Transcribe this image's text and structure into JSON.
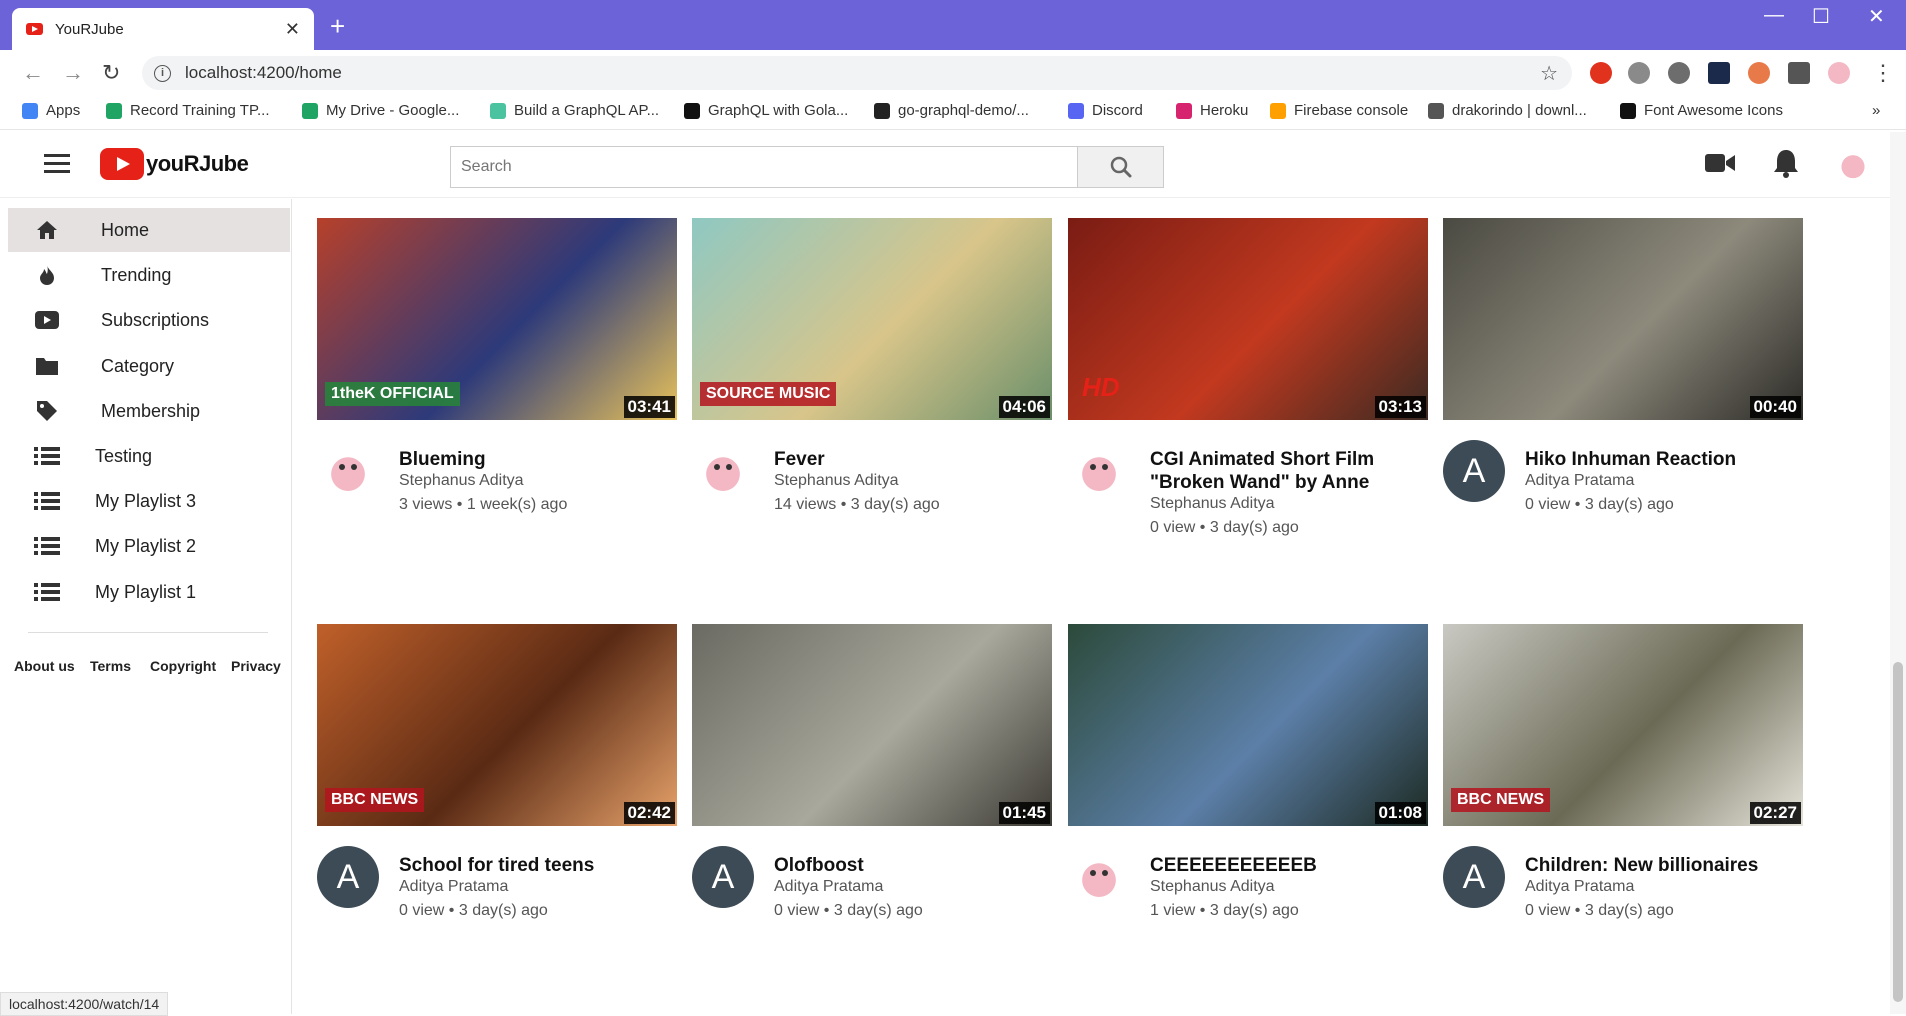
{
  "browser": {
    "tab_title": "YouRJube",
    "tab_close": "✕",
    "new_tab": "+",
    "minimize": "—",
    "maximize": "☐",
    "close": "✕",
    "url": "localhost:4200/home",
    "bookmarks": [
      {
        "label": "Apps",
        "color": "#4285f4"
      },
      {
        "label": "Record Training TP...",
        "color": "#1fa463"
      },
      {
        "label": "My Drive - Google...",
        "color": "#1fa463"
      },
      {
        "label": "Build a GraphQL AP...",
        "color": "#4cc3a0"
      },
      {
        "label": "GraphQL with Gola...",
        "color": "#111111"
      },
      {
        "label": "go-graphql-demo/...",
        "color": "#222222"
      },
      {
        "label": "Discord",
        "color": "#5865f2"
      },
      {
        "label": "Heroku",
        "color": "#d6246e"
      },
      {
        "label": "Firebase console",
        "color": "#ffa000"
      },
      {
        "label": "drakorindo | downl...",
        "color": "#555555"
      },
      {
        "label": "Font Awesome Icons",
        "color": "#111111"
      }
    ],
    "bookmarks_more": "»",
    "status_url": "localhost:4200/watch/14"
  },
  "header": {
    "brand": "youRJube",
    "search_placeholder": "Search"
  },
  "sidebar": {
    "items": [
      {
        "label": "Home",
        "icon": "home-icon"
      },
      {
        "label": "Trending",
        "icon": "fire-icon"
      },
      {
        "label": "Subscriptions",
        "icon": "subscriptions-icon"
      },
      {
        "label": "Category",
        "icon": "folder-icon"
      },
      {
        "label": "Membership",
        "icon": "tag-icon"
      },
      {
        "label": "Testing",
        "icon": "list-icon"
      },
      {
        "label": "My Playlist 3",
        "icon": "list-icon"
      },
      {
        "label": "My Playlist 2",
        "icon": "list-icon"
      },
      {
        "label": "My Playlist 1",
        "icon": "list-icon"
      }
    ],
    "footer": [
      "About us",
      "Terms",
      "Copyright",
      "Privacy"
    ]
  },
  "videos": [
    {
      "title": "Blueming",
      "channel": "Stephanus Aditya",
      "stats": "3 views • 1 week(s) ago",
      "duration": "03:41",
      "avatar": "",
      "thumb_colors": [
        "#b7402a",
        "#2d3a7a",
        "#e9c35a"
      ]
    },
    {
      "title": "Fever",
      "channel": "Stephanus Aditya",
      "stats": "14 views • 3 day(s) ago",
      "duration": "04:06",
      "avatar": "",
      "thumb_colors": [
        "#8fc8c2",
        "#d8c58a",
        "#6a8f6a"
      ]
    },
    {
      "title": "CGI Animated Short Film\n\"Broken Wand\" by Anne Yang...",
      "channel": "Stephanus Aditya",
      "stats": "0 view • 3 day(s) ago",
      "duration": "03:13",
      "avatar": "",
      "thumb_colors": [
        "#7a1c14",
        "#c2391f",
        "#3b2a22"
      ]
    },
    {
      "title": "Hiko Inhuman Reaction",
      "channel": "Aditya Pratama",
      "stats": "0 view • 3 day(s) ago",
      "duration": "00:40",
      "avatar": "A",
      "thumb_colors": [
        "#4b4a42",
        "#8d8a7c",
        "#2c2b27"
      ]
    },
    {
      "title": "School for tired teens",
      "channel": "Aditya Pratama",
      "stats": "0 view • 3 day(s) ago",
      "duration": "02:42",
      "avatar": "A",
      "thumb_colors": [
        "#c0602a",
        "#5a2a14",
        "#e8a36b"
      ]
    },
    {
      "title": "Olofboost",
      "channel": "Aditya Pratama",
      "stats": "0 view • 3 day(s) ago",
      "duration": "01:45",
      "avatar": "A",
      "thumb_colors": [
        "#6a6a62",
        "#a8a89c",
        "#3c3a34"
      ]
    },
    {
      "title": "CEEEEEEEEEEEB",
      "channel": "Stephanus Aditya",
      "stats": "1 view • 3 day(s) ago",
      "duration": "01:08",
      "avatar": "",
      "thumb_colors": [
        "#2c4a3a",
        "#5c7fa8",
        "#1c2a22"
      ]
    },
    {
      "title": "Children: New billionaires",
      "channel": "Aditya Pratama",
      "stats": "0 view • 3 day(s) ago",
      "duration": "02:27",
      "avatar": "A",
      "thumb_colors": [
        "#c9c9c3",
        "#6b6a55",
        "#e6e4da"
      ]
    }
  ],
  "thumb_badges": {
    "v0": "1theK OFFICIAL",
    "v1": "SOURCE MUSIC",
    "v2": "HD",
    "v4": "BBC NEWS",
    "v7": "BBC NEWS"
  }
}
